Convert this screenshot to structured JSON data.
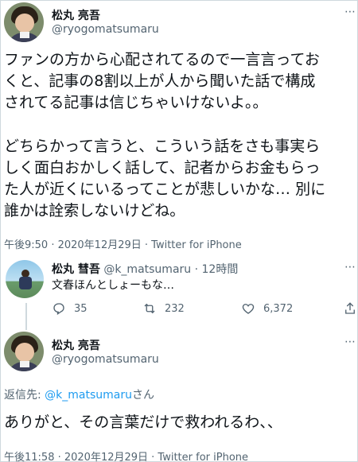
{
  "tweet1": {
    "display_name": "松丸 亮吾",
    "handle": "@ryogomatsumaru",
    "more": "⋯",
    "paragraph1": "ファンの方から心配されてるので一言言ってお\nくと、記事の8割以上が人から聞いた話で構成\nされてる記事は信じちゃいけないよ。。",
    "paragraph2": "どちらかって言うと、こういう話をさも事実ら\nしく面白おかしく話して、記者からお金もらっ\nた人が近くにいるってことが悲しいかな… 別に\n誰かは詮索しないけどね。",
    "meta": "午後9:50 · 2020年12月29日 · Twitter for iPhone"
  },
  "reply": {
    "display_name": "松丸 彗吾",
    "handle": "@k_matsumaru",
    "time": "· 12時間",
    "text": "文春ほんとしょーもな…",
    "more": "⋯",
    "reply_count": "35",
    "retweet_count": "232",
    "like_count": "6,372"
  },
  "tweet2": {
    "display_name": "松丸 亮吾",
    "handle": "@ryogomatsumaru",
    "more": "⋯",
    "reply_to_label": "返信先: ",
    "reply_to_handle": "@k_matsumaru",
    "reply_to_suffix": "さん",
    "text": "ありがと、その言葉だけで救われるわ、、",
    "meta": "午後11:58 · 2020年12月29日 · Twitter for iPhone"
  },
  "colors": {
    "link": "#1d9bf0",
    "secondary": "#536471",
    "border": "#cfd9de"
  }
}
